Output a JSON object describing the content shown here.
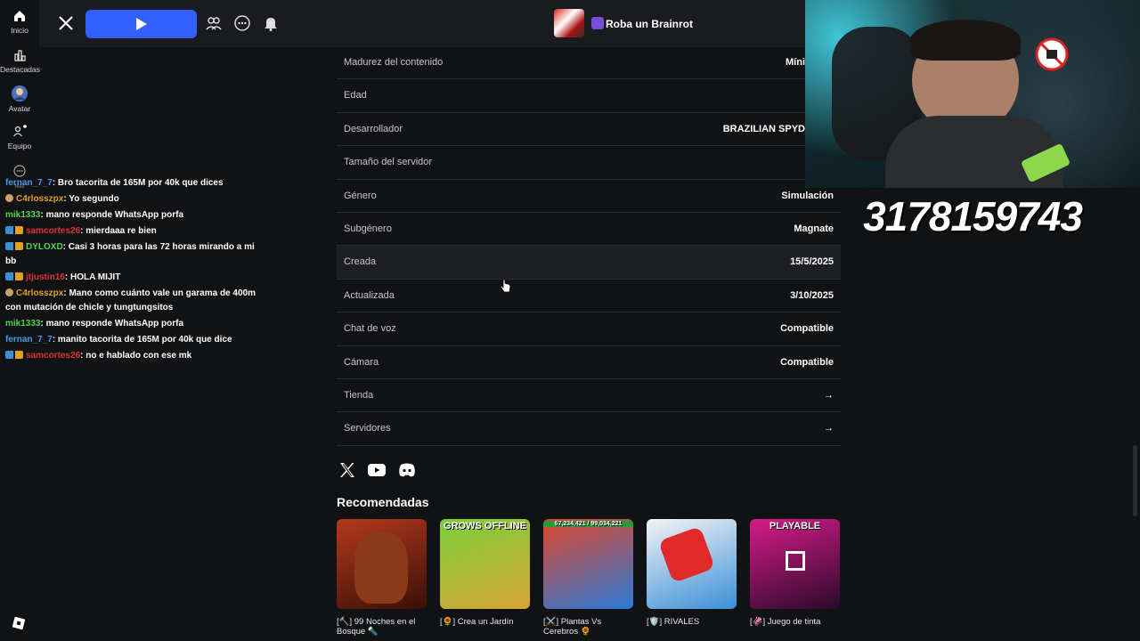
{
  "sidebar": {
    "items": [
      {
        "label": "Inicio"
      },
      {
        "label": "Destacadas"
      },
      {
        "label": "Avatar"
      },
      {
        "label": "Equipo"
      },
      {
        "label": "Más"
      }
    ]
  },
  "topbar": {
    "game_title": "Roba un Brainrot"
  },
  "chat": [
    {
      "user": "fernan_7_7",
      "user_color": "#4a9be8",
      "msg": ": Bro tacorita de 165M por 40k que dices",
      "icons": "none"
    },
    {
      "user": "C4rlosszpx",
      "user_color": "#e3a023",
      "msg": ": Yo segundo",
      "icons": "one"
    },
    {
      "user": "mik1333",
      "user_color": "#4fd34f",
      "msg": ": mano responde WhatsApp porfa",
      "icons": "none"
    },
    {
      "user": "samcortes26",
      "user_color": "#d33",
      "msg": ": mierdaaa re bien",
      "icons": "two"
    },
    {
      "user": "DYLOXD",
      "user_color": "#4fd34f",
      "msg": ": Casi 3 horas para las 72 horas mirando a mi bb",
      "icons": "two"
    },
    {
      "user": "jtjustin16",
      "user_color": "#d33",
      "msg": ": HOLA MIJIT",
      "icons": "two"
    },
    {
      "user": "C4rlosszpx",
      "user_color": "#e3a023",
      "msg": ": Mano como cuánto vale un garama de 400m con mutación de chicle y tungtungsitos",
      "icons": "one"
    },
    {
      "user": "mik1333",
      "user_color": "#4fd34f",
      "msg": ": mano responde WhatsApp porfa",
      "icons": "none"
    },
    {
      "user": "fernan_7_7",
      "user_color": "#4a9be8",
      "msg": ": manito tacorita de 165M por 40k que dice",
      "icons": "none"
    },
    {
      "user": "samcortes26",
      "user_color": "#d33",
      "msg": ": no e hablado con ese mk",
      "icons": "two"
    }
  ],
  "info": [
    {
      "label": "Madurez del contenido",
      "value": "Míni"
    },
    {
      "label": "Edad",
      "value": ""
    },
    {
      "label": "Desarrollador",
      "value": "BRAZILIAN SPYD"
    },
    {
      "label": "Tamaño del servidor",
      "value": ""
    },
    {
      "label": "Género",
      "value": "Simulación"
    },
    {
      "label": "Subgénero",
      "value": "Magnate"
    },
    {
      "label": "Creada",
      "value": "15/5/2025"
    },
    {
      "label": "Actualizada",
      "value": "3/10/2025"
    },
    {
      "label": "Chat de voz",
      "value": "Compatible"
    },
    {
      "label": "Cámara",
      "value": "Compatible"
    },
    {
      "label": "Tienda",
      "value": "→"
    },
    {
      "label": "Servidores",
      "value": "→"
    }
  ],
  "recommended": {
    "title": "Recomendadas",
    "games": [
      {
        "name": "[🔨] 99 Noches en el Bosque 🔦",
        "banner": "",
        "color1": "#b33a1c",
        "color2": "#3a0f08"
      },
      {
        "name": "[🌻] Crea un Jardín",
        "banner": "GROWS OFFLINE",
        "color1": "#7ccf3a",
        "color2": "#d8a23a"
      },
      {
        "name": "[⚔️] Plantas Vs Cerebros 🌻",
        "banner": "67,234,421 / 99,034,221",
        "color1": "#e0452a",
        "color2": "#2a7bd8"
      },
      {
        "name": "[🛡️] RIVALES",
        "banner": "",
        "color1": "#f4f4f4",
        "color2": "#3a8fd8"
      },
      {
        "name": "[🦑] Juego de tinta",
        "banner": "PLAYABLE",
        "color1": "#d81b8a",
        "color2": "#2a0a2a"
      }
    ]
  },
  "stream": {
    "code": "3178159743"
  }
}
